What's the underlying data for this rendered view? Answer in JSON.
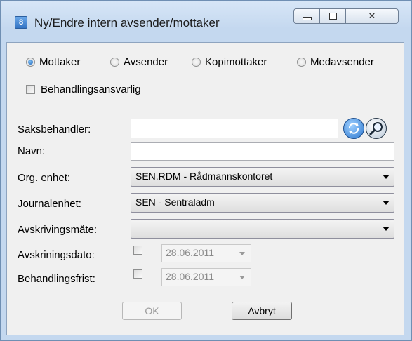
{
  "window": {
    "title": "Ny/Endre intern avsender/mottaker",
    "app_icon_text": "8"
  },
  "roles": {
    "options": [
      "Mottaker",
      "Avsender",
      "Kopimottaker",
      "Medavsender"
    ],
    "selected": "Mottaker"
  },
  "behandlingsansvarlig": {
    "label": "Behandlingsansvarlig",
    "checked": false
  },
  "form": {
    "saksbehandler": {
      "label": "Saksbehandler:",
      "value": ""
    },
    "navn": {
      "label": "Navn:",
      "value": ""
    },
    "org_enhet": {
      "label": "Org. enhet:",
      "value": "SEN.RDM - Rådmannskontoret"
    },
    "journalenhet": {
      "label": "Journalenhet:",
      "value": "SEN - Sentraladm"
    },
    "avskrivingsmate": {
      "label": "Avskrivingsmåte:",
      "value": ""
    },
    "avskriningsdato": {
      "label": "Avskriningsdato:",
      "checked": false,
      "date": "28.06.2011"
    },
    "behandlingsfrist": {
      "label": "Behandlingsfrist:",
      "checked": false,
      "date": "28.06.2011"
    }
  },
  "buttons": {
    "ok": "OK",
    "cancel": "Avbryt"
  },
  "colors": {
    "titlebar": "#c4d8ef",
    "client": "#f0f0f0",
    "accent": "#2d78cf"
  }
}
